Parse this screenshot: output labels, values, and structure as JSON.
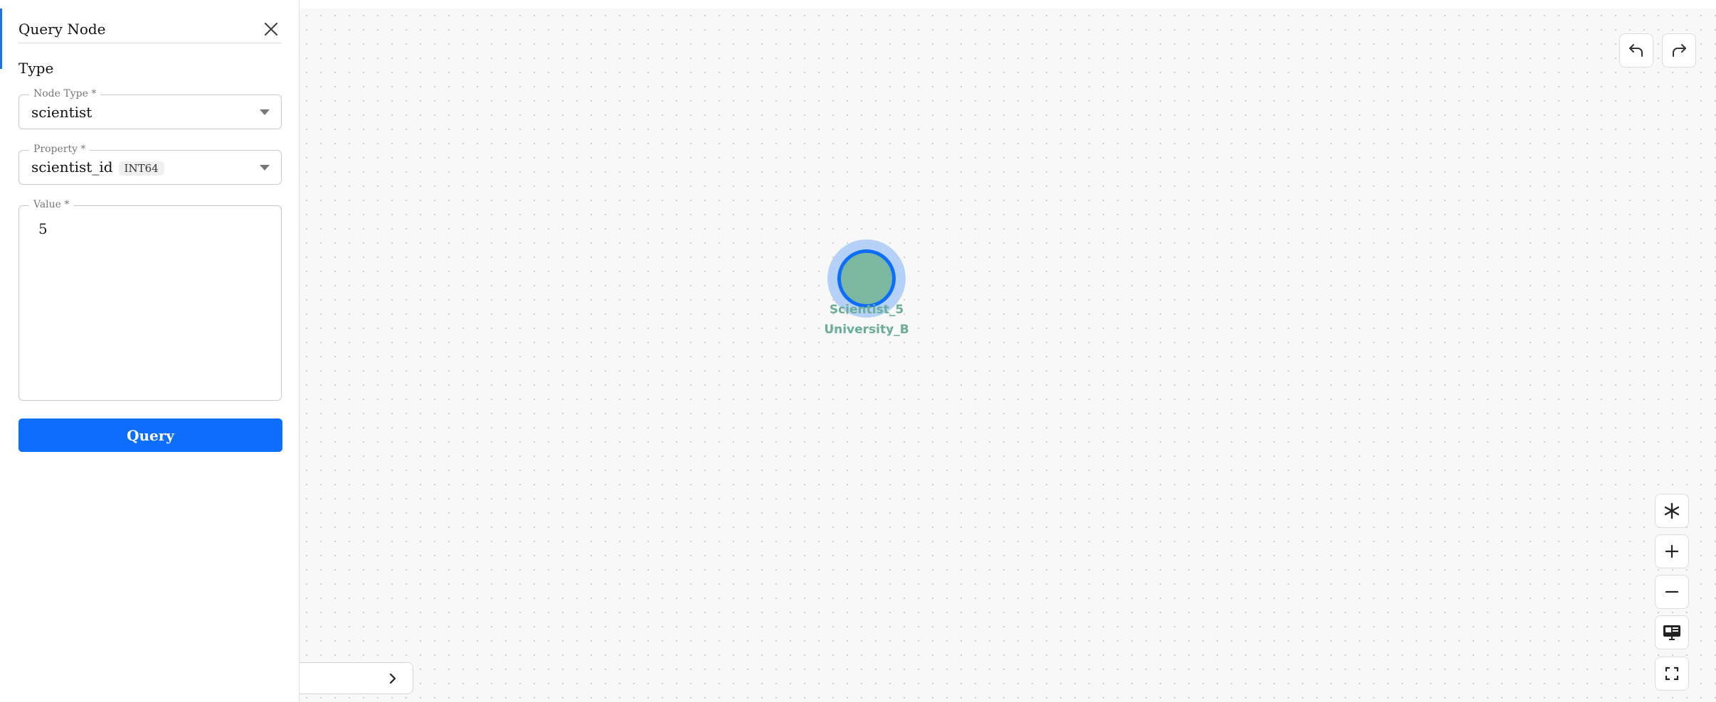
{
  "panel": {
    "title": "Query Node",
    "section_label": "Type",
    "node_type": {
      "label": "Node Type *",
      "value": "scientist"
    },
    "property": {
      "label": "Property *",
      "value": "scientist_id",
      "type_chip": "INT64"
    },
    "value": {
      "label": "Value *",
      "value": "5"
    },
    "query_button": "Query"
  },
  "graph": {
    "node": {
      "label_line1": "Scientist_5",
      "label_line2": "University_B",
      "fill_color": "#7cb8a1",
      "ring_color": "#0d6efd",
      "halo_color": "#b5d1f7",
      "label_color": "#69ad96"
    }
  },
  "toolbar_icons": [
    "undo-icon",
    "redo-icon",
    "layout-icon",
    "zoom-in-icon",
    "zoom-out-icon",
    "screen-icon",
    "fullscreen-icon",
    "chevron-right-icon"
  ],
  "colors": {
    "accent": "#0d6efd"
  }
}
